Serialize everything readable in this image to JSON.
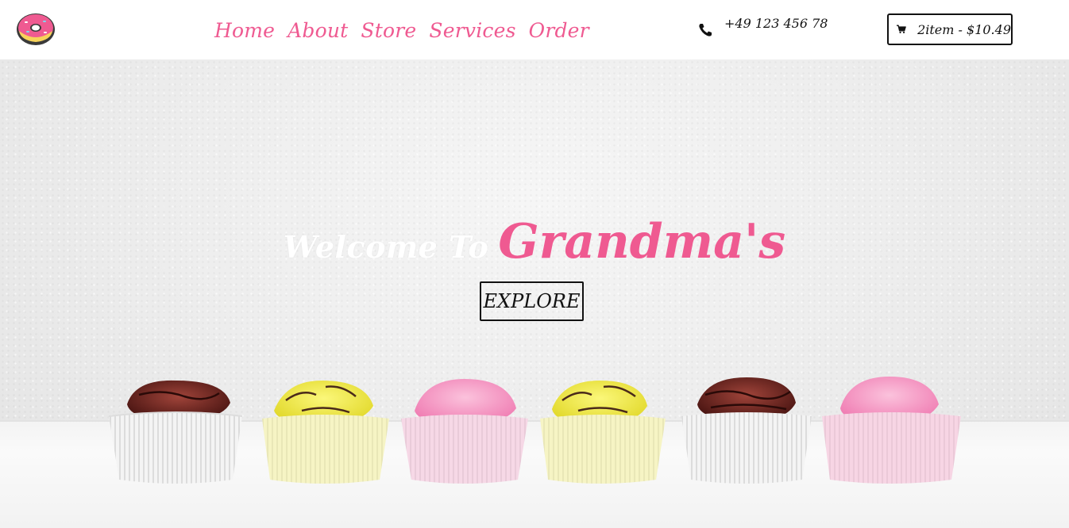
{
  "header": {
    "nav": [
      "Home",
      "About",
      "Store",
      "Services",
      "Order"
    ],
    "phone": "+49 123 456 78",
    "cart": "2item - $10.49"
  },
  "hero": {
    "welcome": "Welcome To",
    "brand": "Grandma's",
    "cta": "EXPLORE"
  },
  "colors": {
    "accent": "#ef5a91",
    "text": "#111111"
  },
  "icons": [
    "donut-logo-icon",
    "phone-icon",
    "shopping-cart-icon"
  ]
}
